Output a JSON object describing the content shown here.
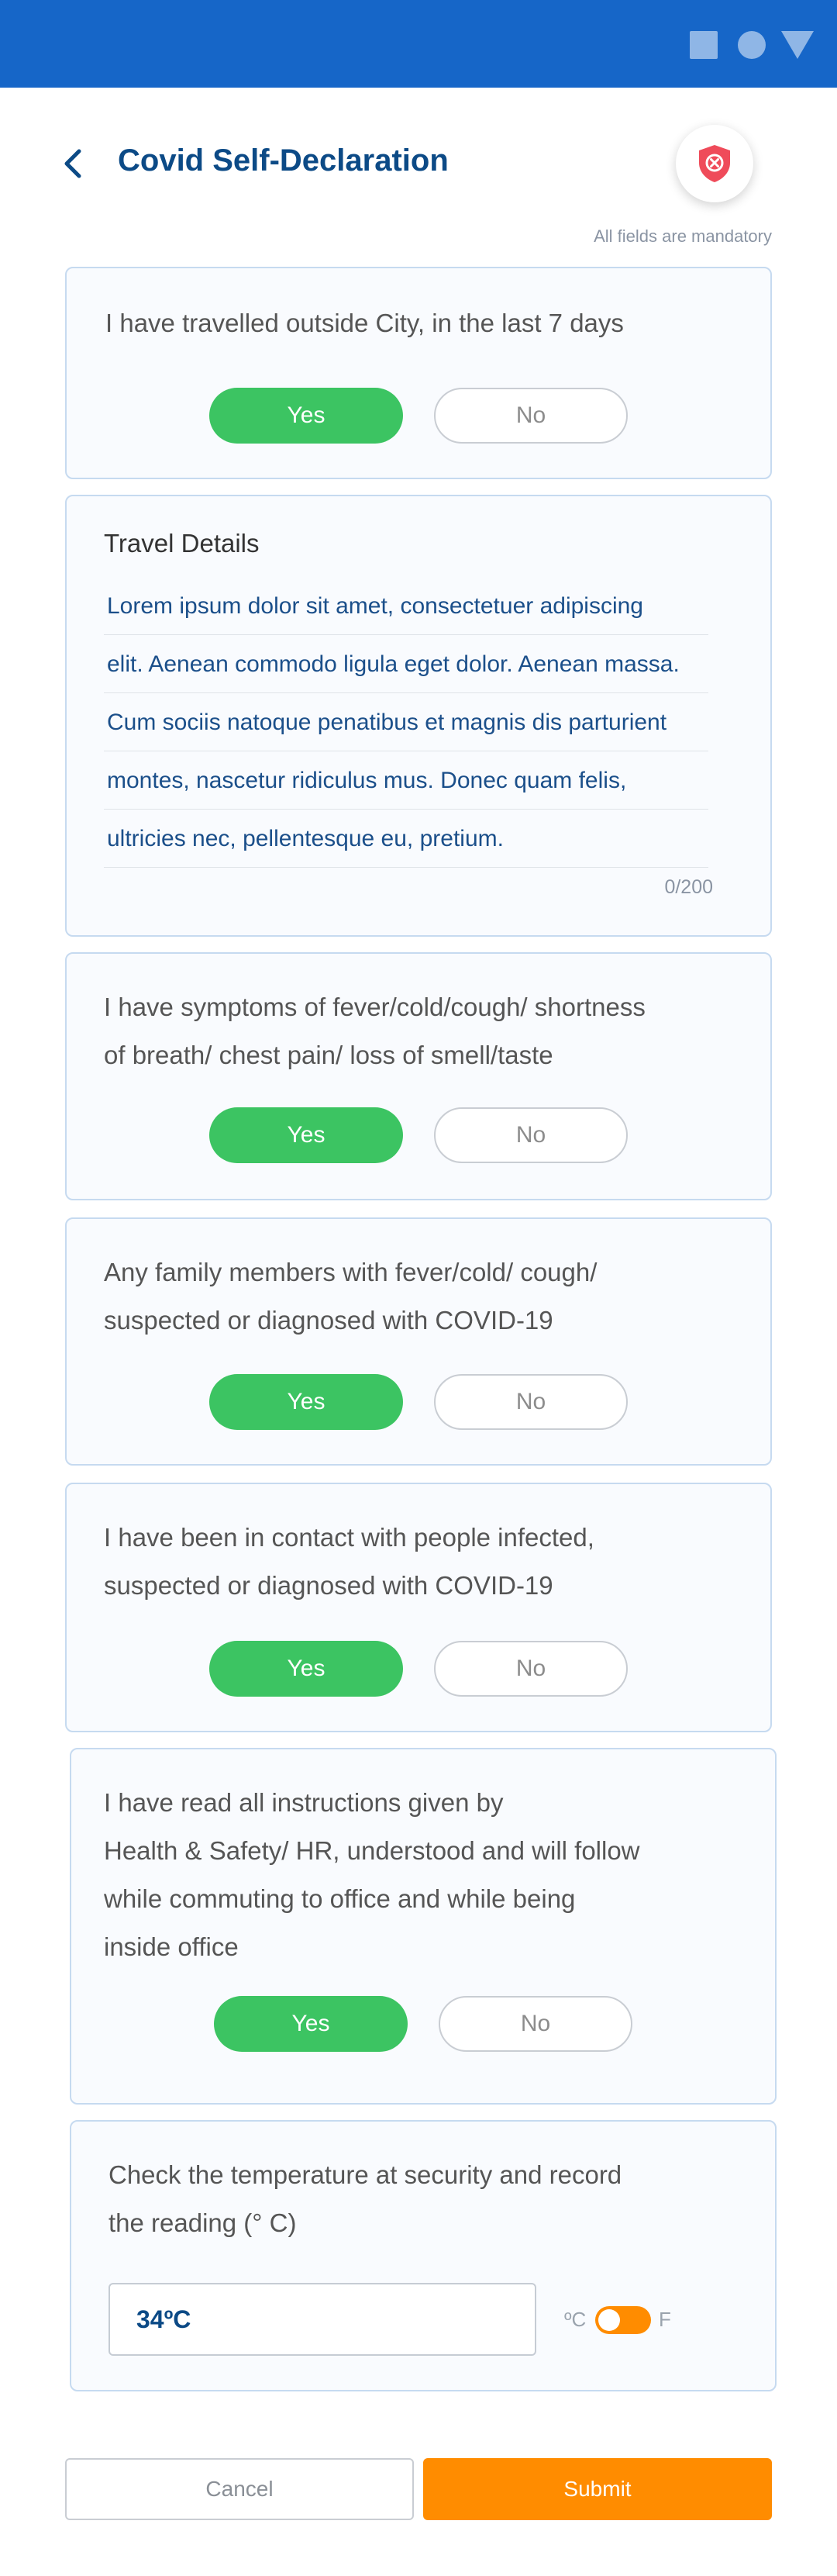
{
  "status_bar": {
    "icons": [
      "square-icon",
      "circle-icon",
      "triangle-icon"
    ]
  },
  "header": {
    "title": "Covid Self-Declaration",
    "back_icon": "chevron-left-icon",
    "action_icon": "shield-icon"
  },
  "note": "All fields are mandatory",
  "questions": [
    {
      "text": [
        "I have travelled outside City, in the last 7 days"
      ],
      "yes_label": "Yes",
      "no_label": "No",
      "selected": "Yes"
    },
    {
      "text": [
        "I have symptoms of fever/cold/cough/ shortness",
        "of breath/ chest pain/ loss of smell/taste"
      ],
      "yes_label": "Yes",
      "no_label": "No",
      "selected": "Yes"
    },
    {
      "text": [
        "Any family members with fever/cold/ cough/",
        "suspected or diagnosed with COVID-19"
      ],
      "yes_label": "Yes",
      "no_label": "No",
      "selected": "Yes"
    },
    {
      "text": [
        "I have been in contact with people infected,",
        "suspected or diagnosed with COVID-19"
      ],
      "yes_label": "Yes",
      "no_label": "No",
      "selected": "Yes"
    },
    {
      "text": [
        "I have read all instructions given by",
        "Health & Safety/ HR, understood and will follow",
        "while commuting to office and while being",
        "inside office"
      ],
      "yes_label": "Yes",
      "no_label": "No",
      "selected": "Yes"
    }
  ],
  "travel_details": {
    "title": "Travel Details",
    "lines": [
      "Lorem ipsum dolor sit amet, consectetuer adipiscing",
      "elit. Aenean commodo ligula eget dolor. Aenean massa.",
      "Cum sociis natoque penatibus et magnis dis parturient",
      "montes, nascetur ridiculus mus. Donec quam felis,",
      "ultricies nec, pellentesque eu, pretium."
    ],
    "counter": "0/200"
  },
  "temperature": {
    "text": [
      "Check the temperature at security and record",
      "the reading (° C)"
    ],
    "value": "34ºC",
    "unit_c": "ºC",
    "unit_f": "F",
    "selected_unit": "C"
  },
  "footer": {
    "cancel_label": "Cancel",
    "submit_label": "Submit"
  },
  "colors": {
    "primary": "#1666c8",
    "title": "#0c4a86",
    "yes": "#3cc462",
    "accent": "#ff8c00",
    "card_border": "#c6daf0"
  }
}
